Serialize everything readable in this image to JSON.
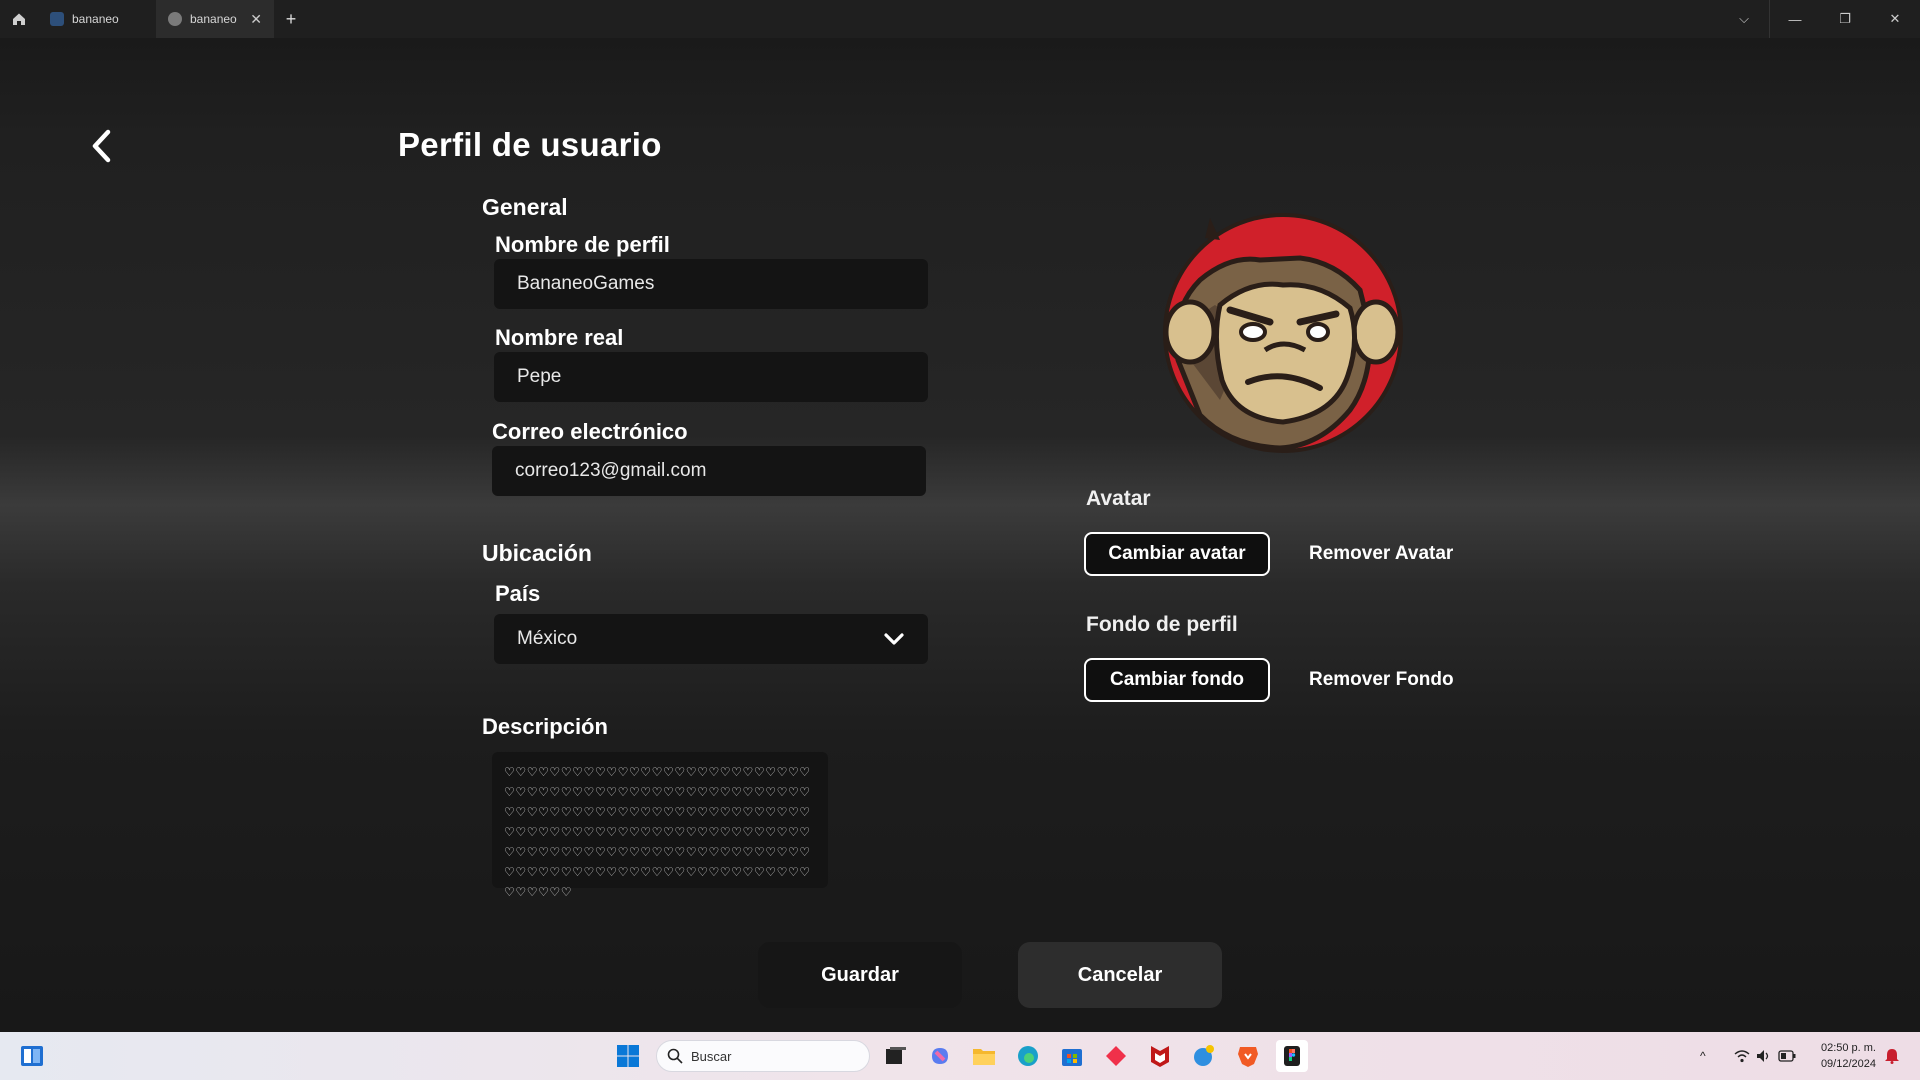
{
  "window": {
    "tabs": [
      {
        "label": "bananeo",
        "active": false
      },
      {
        "label": "bananeo",
        "active": true
      }
    ]
  },
  "page": {
    "title": "Perfil de usuario"
  },
  "general": {
    "heading": "General",
    "profile_name_label": "Nombre de perfil",
    "profile_name_value": "BananeoGames",
    "real_name_label": "Nombre real",
    "real_name_value": "Pepe",
    "email_label": "Correo electrónico",
    "email_value": "correo123@gmail.com"
  },
  "location": {
    "heading": "Ubicación",
    "country_label": "País",
    "country_value": "México"
  },
  "description": {
    "label": "Descripción",
    "value": "♡♡♡♡♡♡♡♡♡♡♡♡♡♡♡♡♡♡♡♡♡♡♡♡♡♡♡♡♡♡♡♡♡♡♡♡♡♡♡♡♡♡♡♡♡♡♡♡♡♡♡♡♡♡♡♡♡♡♡♡♡♡♡♡♡♡♡♡♡♡♡♡♡♡♡♡♡♡♡♡♡♡♡♡♡♡♡♡♡♡♡♡♡♡♡♡♡♡♡♡♡♡♡♡♡♡♡♡♡♡♡♡♡♡♡♡♡♡♡♡♡♡♡♡♡♡♡♡♡♡♡♡♡♡♡♡♡♡♡♡♡♡♡♡♡♡♡♡♡♡♡♡♡♡♡♡♡♡♡♡♡♡♡♡♡♡♡♡"
  },
  "avatar_section": {
    "avatar_label": "Avatar",
    "change_avatar": "Cambiar avatar",
    "remove_avatar": "Remover Avatar",
    "background_label": "Fondo de perfil",
    "change_background": "Cambiar fondo",
    "remove_background": "Remover Fondo"
  },
  "actions": {
    "save": "Guardar",
    "cancel": "Cancelar"
  },
  "taskbar": {
    "search_placeholder": "Buscar",
    "time": "02:50 p. m.",
    "date": "09/12/2024"
  },
  "colors": {
    "background": "#1b1b1b",
    "field_bg": "#141414",
    "avatar_ring": "#d0202a",
    "cancel_bg": "#2d2d2d"
  }
}
